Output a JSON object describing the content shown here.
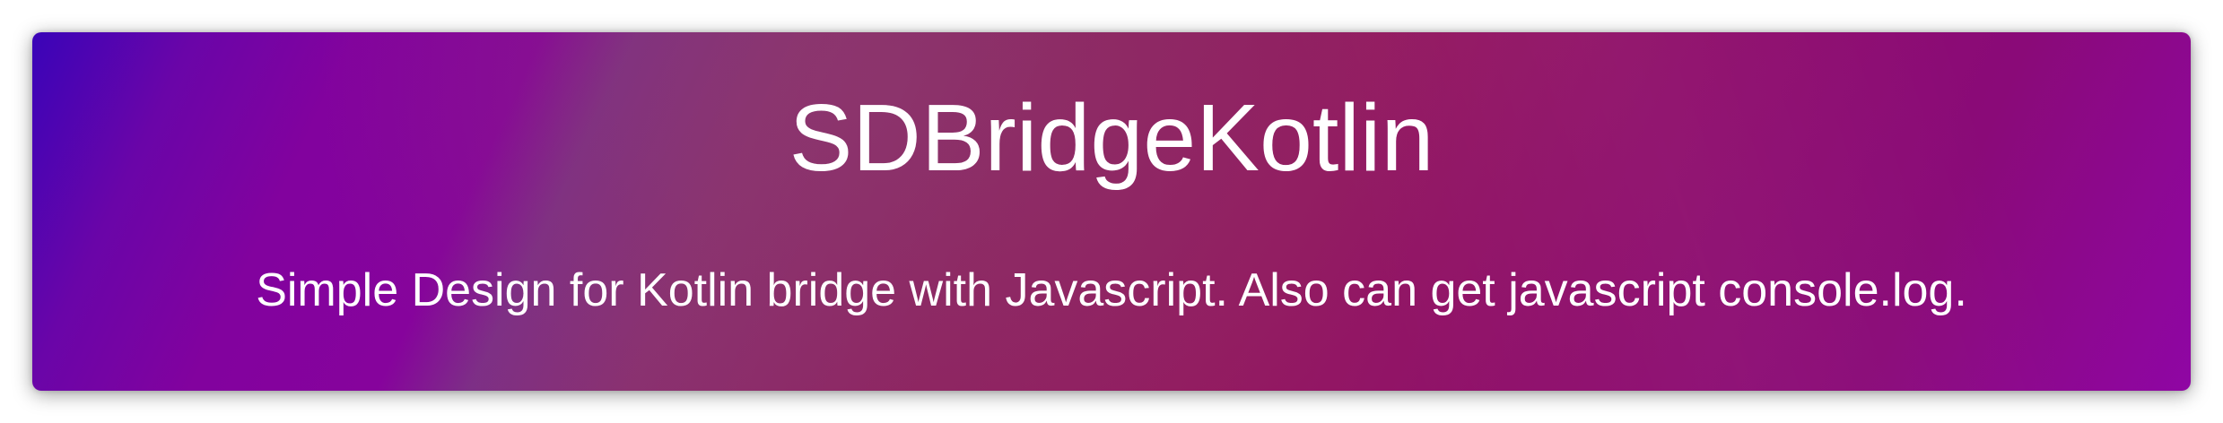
{
  "banner": {
    "title": "SDBridgeKotlin",
    "description": "Simple Design for Kotlin bridge with Javascript. Also can get javascript console.log."
  },
  "colors": {
    "gradient_start": "#3a04b8",
    "gradient_mid": "#8e2260",
    "gradient_end": "#8f06a4",
    "text": "#ffffff"
  }
}
